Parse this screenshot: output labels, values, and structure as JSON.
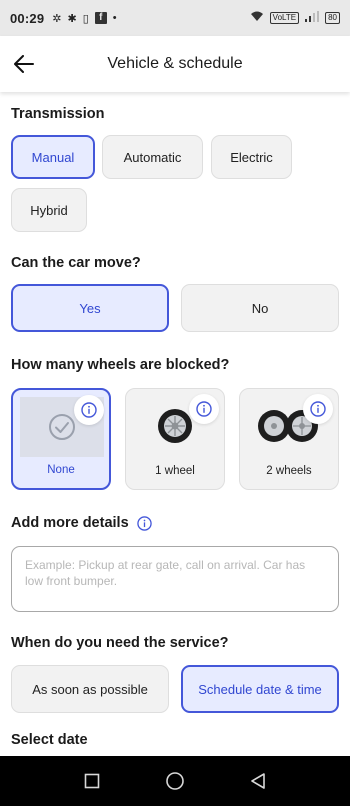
{
  "status_bar": {
    "time": "00:29",
    "network_label": "VoLTE",
    "battery_label": "80"
  },
  "header": {
    "title": "Vehicle & schedule"
  },
  "transmission": {
    "title": "Transmission",
    "options": [
      "Manual",
      "Automatic",
      "Electric",
      "Hybrid"
    ],
    "selected": "Manual"
  },
  "car_move": {
    "title": "Can the car move?",
    "options": [
      "Yes",
      "No"
    ],
    "selected": "Yes"
  },
  "wheels": {
    "title": "How many wheels are blocked?",
    "options": [
      "None",
      "1 wheel",
      "2 wheels"
    ],
    "selected": "None"
  },
  "details": {
    "title": "Add more details",
    "placeholder": "Example: Pickup at rear gate, call on arrival. Car has low front bumper."
  },
  "service_time": {
    "title": "When do you need the service?",
    "options": [
      "As soon as possible",
      "Schedule date & time"
    ],
    "selected": "Schedule date & time"
  },
  "select_date": {
    "title": "Select date"
  },
  "colors": {
    "accent": "#4457d9",
    "accent_bg": "#e7ebff",
    "chip_bg": "#f2f2f2"
  }
}
